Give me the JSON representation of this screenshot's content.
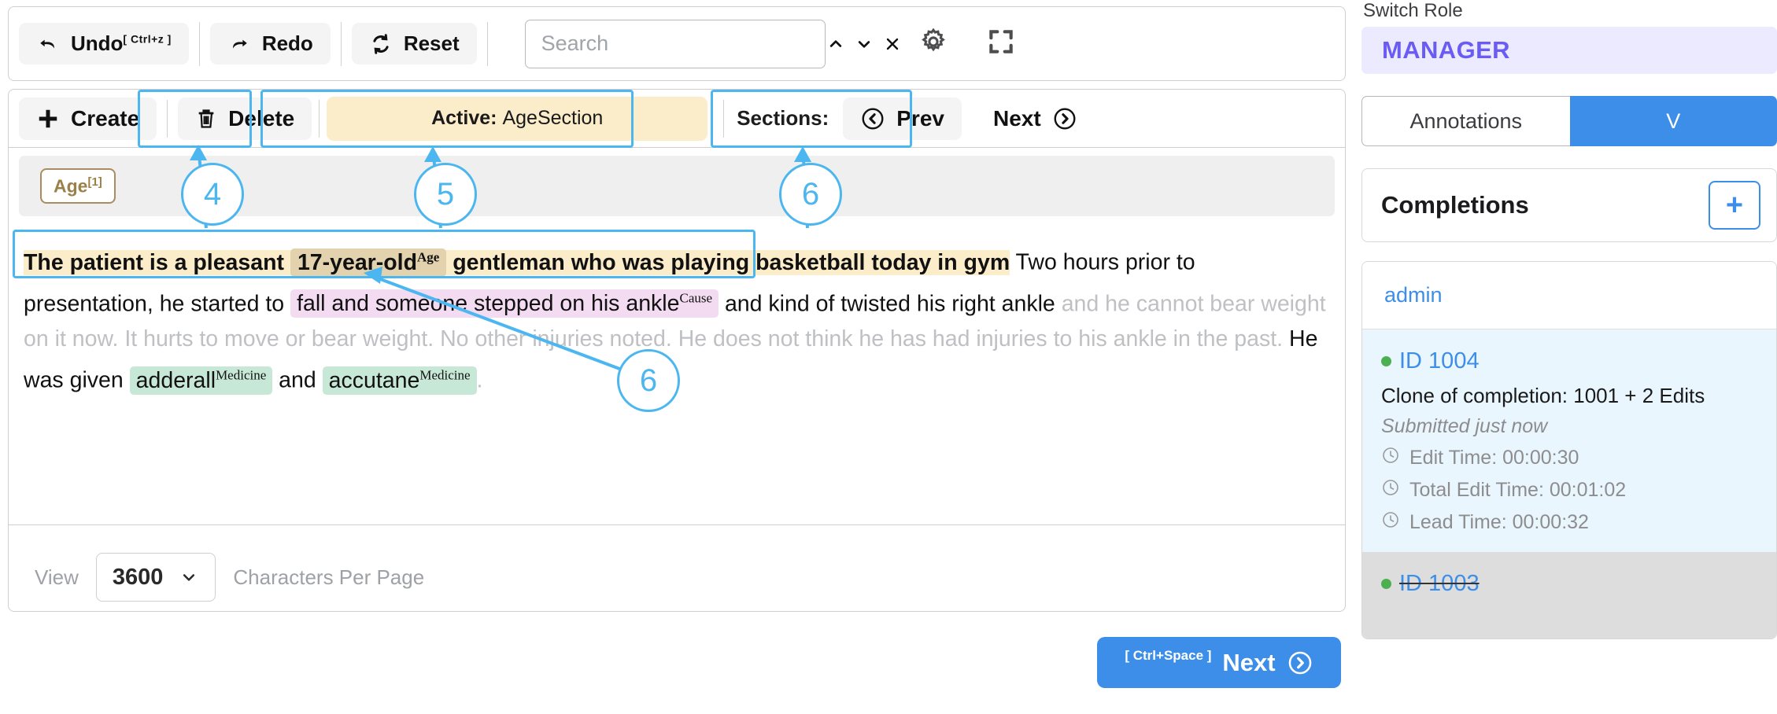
{
  "toolbar_top": {
    "undo_label": "Undo",
    "undo_shortcut": "[ Ctrl+z ]",
    "redo_label": "Redo",
    "reset_label": "Reset",
    "search_placeholder": "Search",
    "search_value": ""
  },
  "toolbar_sections": {
    "create_label": "Create",
    "delete_label": "Delete",
    "active_prefix": "Active:",
    "active_section": "AgeSection",
    "sections_label": "Sections:",
    "prev_label": "Prev",
    "next_label": "Next"
  },
  "labels": {
    "chips": [
      {
        "name": "Age",
        "index": "[1]"
      }
    ]
  },
  "document": {
    "line1_pre": "The patient is a pleasant ",
    "age_value": "17-year-old",
    "age_sup": "Age",
    "line1_post": " gentleman who was playing basketball today in gym",
    "line1_tail": " Two hours prior to presentation, he started to ",
    "cause_value": "fall and someone stepped on his ankle",
    "cause_sup": "Cause",
    "line2_mid": " and kind of twisted his right ankle",
    "dim1": " and he cannot bear weight on it now. It hurts to move or bear weight. No other injuries noted. He does not think he has had injuries to his ankle in the past. ",
    "line3_pre": "He was given ",
    "med1_value": "adderall",
    "med1_sup": "Medicine",
    "line3_and": " and ",
    "med2_value": "accutane",
    "med2_sup": "Medicine",
    "line3_end": "."
  },
  "view_bar": {
    "view_label": "View",
    "chars_value": "3600",
    "chars_label": "Characters Per Page"
  },
  "next_cta": {
    "shortcut": "[ Ctrl+Space ]",
    "label": "Next"
  },
  "callouts": [
    {
      "id": "c4",
      "number": "4"
    },
    {
      "id": "c5",
      "number": "5"
    },
    {
      "id": "c6a",
      "number": "6"
    },
    {
      "id": "c6b",
      "number": "6"
    }
  ],
  "sidebar": {
    "switch_role_label": "Switch Role",
    "role": "MANAGER",
    "tabs": [
      {
        "label": "Annotations",
        "active": false
      },
      {
        "label": "V",
        "active": true
      }
    ],
    "completions_title": "Completions",
    "add_button": "+",
    "user": "admin",
    "completions": [
      {
        "id": "ID 1004",
        "subtitle": "Clone of completion: 1001 + 2 Edits",
        "submitted": "Submitted just now",
        "metrics": [
          "Edit Time: 00:00:30",
          "Total Edit Time: 00:01:02",
          "Lead Time: 00:00:32"
        ],
        "state": "selected",
        "struck": false
      },
      {
        "id": "ID 1003",
        "subtitle": "",
        "submitted": "",
        "metrics": [],
        "state": "dimmed",
        "struck": true
      }
    ]
  },
  "colors": {
    "accent_blue": "#3d8ee8",
    "callout_blue": "#4bb6ef",
    "role_purple": "#6a5cf2",
    "age_highlight": "#fbecca",
    "cause_highlight": "#f3dcf2",
    "medicine_highlight": "#c8e8d7",
    "status_green": "#4caf50"
  }
}
